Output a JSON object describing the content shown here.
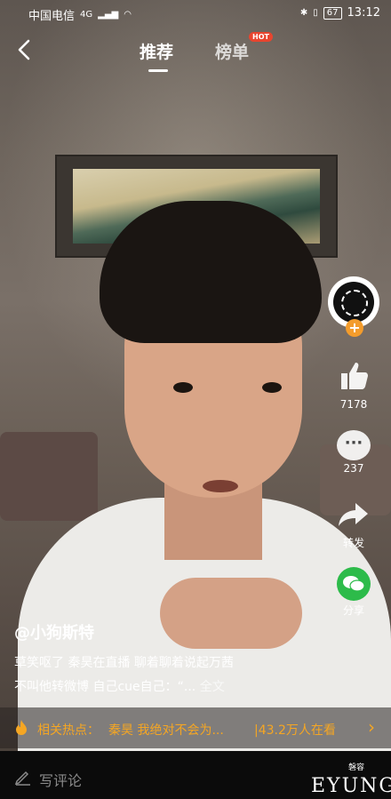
{
  "status_bar": {
    "carrier": "中国电信",
    "network": "4G",
    "battery": "67",
    "time": "13:12"
  },
  "nav": {
    "back_icon": "chevron-left-icon",
    "tabs": [
      {
        "label": "推荐",
        "active": true
      },
      {
        "label": "榜单",
        "active": false,
        "badge": "HOT"
      }
    ]
  },
  "side_actions": {
    "like_count": "7178",
    "comment_count": "237",
    "share_label": "转发",
    "wechat_label": "分享"
  },
  "post": {
    "username": "@小狗斯特",
    "caption_line1": "草笑呕了 秦昊在直播 聊着聊着说起万茜",
    "caption_line2": "不叫他转微博 自己cue自己：“...",
    "full_text_label": "全文"
  },
  "trending": {
    "label": "相关热点：",
    "topic": "秦昊 我绝对不会为...",
    "viewers": "|43.2万人在看"
  },
  "comment_bar": {
    "placeholder": "写评论"
  },
  "watermark": {
    "text": "EYUNG",
    "sub": "磐容"
  },
  "colors": {
    "accent_orange": "#f5a623",
    "hot_red": "#e8452f",
    "wechat_green": "#2dbb4a",
    "follow_orange": "#f39c2c"
  }
}
